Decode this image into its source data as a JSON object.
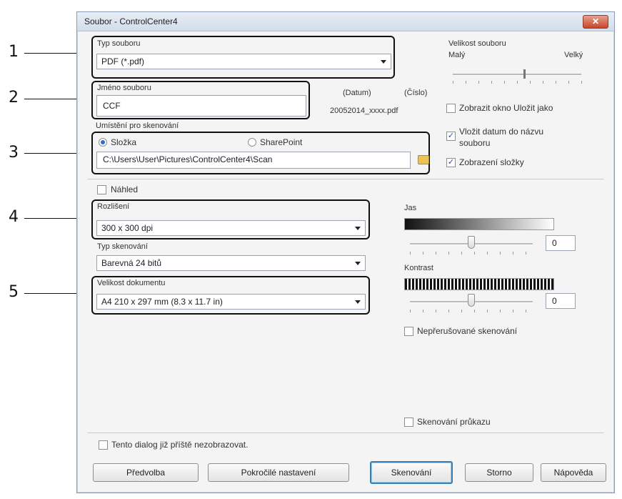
{
  "window": {
    "title": "Soubor - ControlCenter4",
    "close_label": "✕"
  },
  "callouts": [
    "1",
    "2",
    "3",
    "4",
    "5"
  ],
  "file_type": {
    "label": "Typ souboru",
    "value": "PDF (*.pdf)"
  },
  "file_name": {
    "label": "Jméno souboru",
    "value": "CCF",
    "date_label": "(Datum)",
    "number_label": "(Číslo)",
    "preview": "20052014_xxxx.pdf"
  },
  "file_size": {
    "label": "Velikost souboru",
    "min_label": "Malý",
    "max_label": "Velký",
    "level": 0.55
  },
  "options": {
    "show_save_as": {
      "label": "Zobrazit okno Uložit jako",
      "checked": false
    },
    "insert_date": {
      "label_line1": "Vložit datum do názvu",
      "label_line2": "souboru",
      "checked": true
    },
    "show_folder": {
      "label": "Zobrazení složky",
      "checked": true
    }
  },
  "scan_location": {
    "label": "Umístění pro skenování",
    "folder_option": "Složka",
    "sharepoint_option": "SharePoint",
    "path": "C:\\Users\\User\\Pictures\\ControlCenter4\\Scan"
  },
  "preview_option": {
    "label": "Náhled",
    "checked": false
  },
  "resolution": {
    "label": "Rozlišení",
    "value": "300 x 300 dpi"
  },
  "scan_type": {
    "label": "Typ skenování",
    "value": "Barevná 24 bitů"
  },
  "doc_size": {
    "label": "Velikost dokumentu",
    "value": "A4 210 x 297 mm (8.3 x 11.7 in)"
  },
  "brightness": {
    "label": "Jas",
    "value": "0"
  },
  "contrast": {
    "label": "Kontrast",
    "value": "0"
  },
  "continuous_scan": {
    "label": "Nepřerušované skenování",
    "checked": false
  },
  "id_card_scan": {
    "label": "Skenování průkazu",
    "checked": false
  },
  "dont_show": {
    "label": "Tento dialog již příště nezobrazovat.",
    "checked": false
  },
  "buttons": {
    "preset": "Předvolba",
    "advanced": "Pokročilé nastavení",
    "scan": "Skenování",
    "cancel": "Storno",
    "help": "Nápověda"
  }
}
